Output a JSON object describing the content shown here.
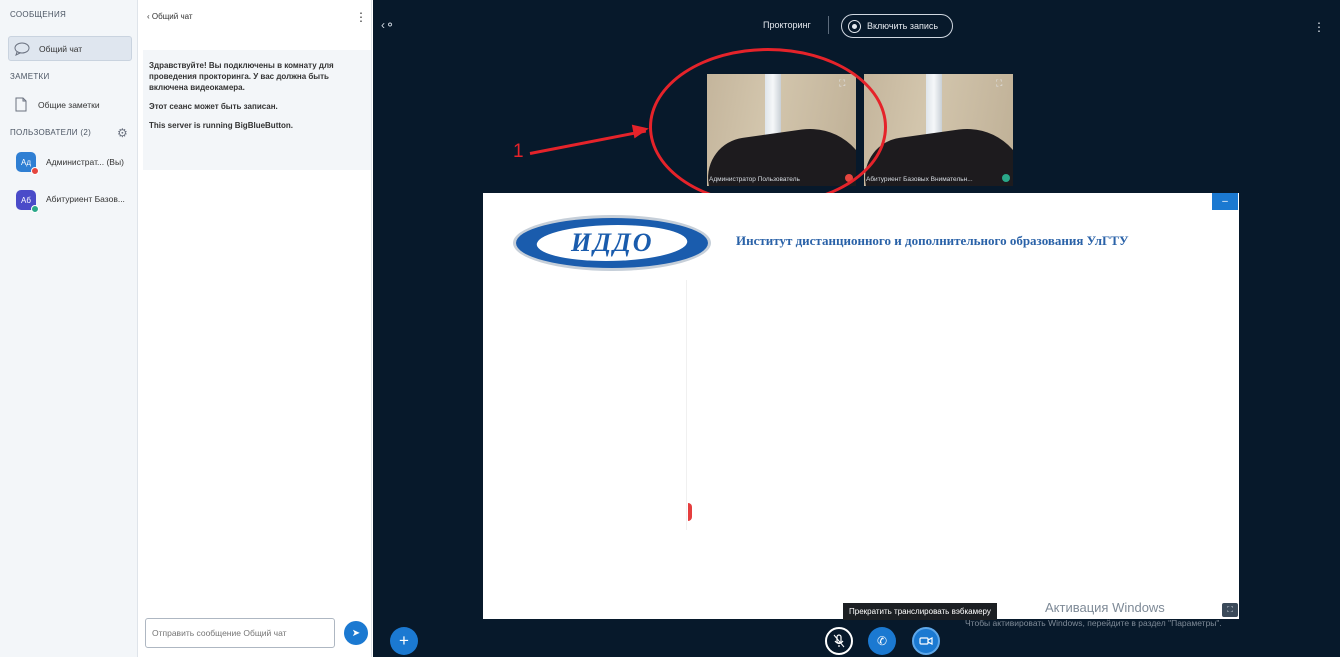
{
  "sidebar": {
    "messages_title": "СООБЩЕНИЯ",
    "public_chat_label": "Общий чат",
    "notes_title": "ЗАМЕТКИ",
    "shared_notes_label": "Общие заметки",
    "users_title": "ПОЛЬЗОВАТЕЛИ (2)",
    "users": [
      {
        "initials": "Ад",
        "name": "Администрат... (Вы)",
        "color": "#2f7fd3",
        "badge": "#e5463f"
      },
      {
        "initials": "Аб",
        "name": "Абитуриент Базов...",
        "color": "#4a4bc9",
        "badge": "#2aa889"
      }
    ]
  },
  "chat": {
    "header": "Общий чат",
    "welcome_lines": [
      "Здравствуйте! Вы подключены в комнату для проведения прокторинга. У вас должна быть включена видеокамера.",
      "Этот сеанс может быть записан.",
      "This server is running BigBlueButton."
    ],
    "input_placeholder": "Отправить сообщение Общий чат"
  },
  "topbar": {
    "title": "Прокторинг",
    "record_label": "Включить запись"
  },
  "webcams": [
    {
      "label": "Администратор Пользователь",
      "mute_color": "#e5463f"
    },
    {
      "label": "Абитуриент Базовых Внимательн...",
      "mute_color": "#2aa889"
    }
  ],
  "annotation": {
    "number": "1",
    "color": "#e5232a"
  },
  "slide": {
    "logo_text": "ИДДО",
    "title": "Институт дистанционного и дополнительного образования УлГТУ"
  },
  "tooltip": "Прекратить транслировать вэбкамеру",
  "watermark": {
    "line1": "Активация Windows",
    "line2": "Чтобы активировать Windows, перейдите в раздел \"Параметры\"."
  },
  "colors": {
    "accent": "#1b79d1",
    "main_bg": "#07192b",
    "sidebar_bg": "#f3f6f9"
  }
}
